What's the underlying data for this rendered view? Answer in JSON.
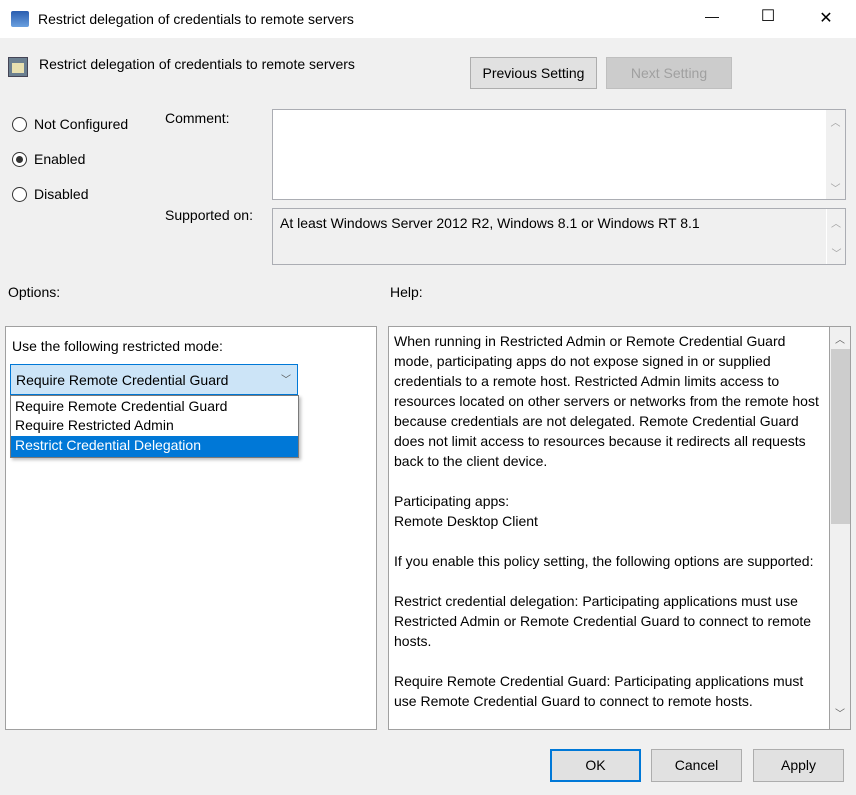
{
  "window": {
    "title": "Restrict delegation of credentials to remote servers",
    "minimize": "—",
    "maximize": "☐",
    "close": "✕"
  },
  "header": {
    "title": "Restrict delegation of credentials to remote servers",
    "previous_label": "Previous Setting",
    "next_label": "Next Setting"
  },
  "state": {
    "options": [
      "Not Configured",
      "Enabled",
      "Disabled"
    ],
    "selected": "Enabled"
  },
  "comment": {
    "label": "Comment:",
    "value": ""
  },
  "supported": {
    "label": "Supported on:",
    "value": "At least Windows Server 2012 R2, Windows 8.1 or Windows RT 8.1"
  },
  "options": {
    "label": "Options:",
    "mode_label": "Use the following restricted mode:",
    "selected": "Require Remote Credential Guard",
    "items": [
      "Require Remote Credential Guard",
      "Require Restricted Admin",
      "Restrict Credential Delegation"
    ],
    "highlighted": "Restrict Credential Delegation"
  },
  "help": {
    "label": "Help:",
    "paragraphs": [
      "When running in Restricted Admin or Remote Credential Guard mode, participating apps do not expose signed in or supplied credentials to a remote host. Restricted Admin limits access to resources located on other servers or networks from the remote host because credentials are not delegated. Remote Credential Guard does not limit access to resources because it redirects all requests back to the client device.",
      "Participating apps:",
      "Remote Desktop Client",
      "If you enable this policy setting, the following options are supported:",
      "Restrict credential delegation: Participating applications must use Restricted Admin or Remote Credential Guard to connect to remote hosts.",
      "Require Remote Credential Guard: Participating applications must use Remote Credential Guard to connect to remote hosts."
    ]
  },
  "footer": {
    "ok": "OK",
    "cancel": "Cancel",
    "apply": "Apply"
  },
  "colors": {
    "accent": "#0078d7",
    "combo_bg": "#cce4f7"
  }
}
